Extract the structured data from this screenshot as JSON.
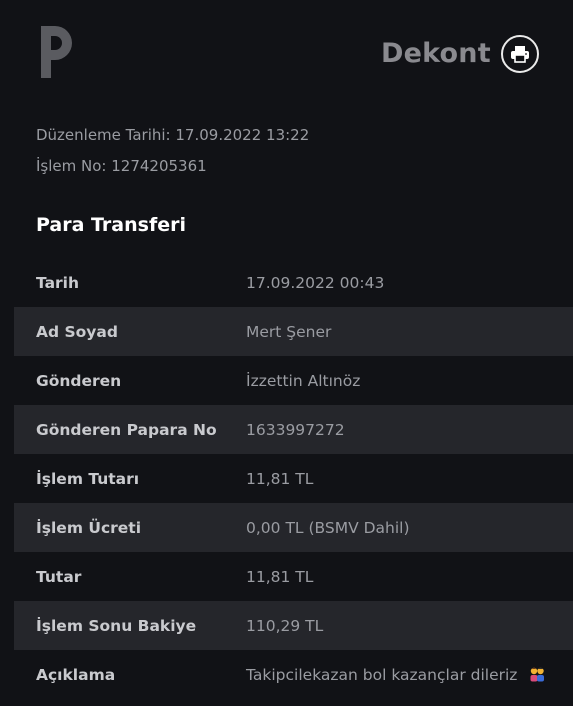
{
  "header": {
    "title": "Dekont",
    "logo_icon": "papara-p-logo",
    "print_icon": "printer-icon"
  },
  "meta": {
    "edit_date": "Düzenleme Tarihi: 17.09.2022 13:22",
    "transaction_no": "İşlem No: 1274205361"
  },
  "section": {
    "title": "Para Transferi"
  },
  "rows": [
    {
      "label": "Tarih",
      "value": "17.09.2022 00:43"
    },
    {
      "label": "Ad Soyad",
      "value": "Mert Şener"
    },
    {
      "label": "Gönderen",
      "value": "İzzettin Altınöz"
    },
    {
      "label": "Gönderen Papara No",
      "value": "1633997272"
    },
    {
      "label": "İşlem Tutarı",
      "value": "11,81 TL"
    },
    {
      "label": "İşlem Ücreti",
      "value": "0,00 TL (BSMV Dahil)"
    },
    {
      "label": "Tutar",
      "value": "11,81 TL"
    },
    {
      "label": "İşlem Sonu Bakiye",
      "value": "110,29 TL"
    },
    {
      "label": "Açıklama",
      "value": "Takipcilekazan bol kazançlar dileriz"
    }
  ],
  "colors": {
    "background": "#111216",
    "row_alt": "#25262b",
    "logo": "#5a5b60"
  }
}
